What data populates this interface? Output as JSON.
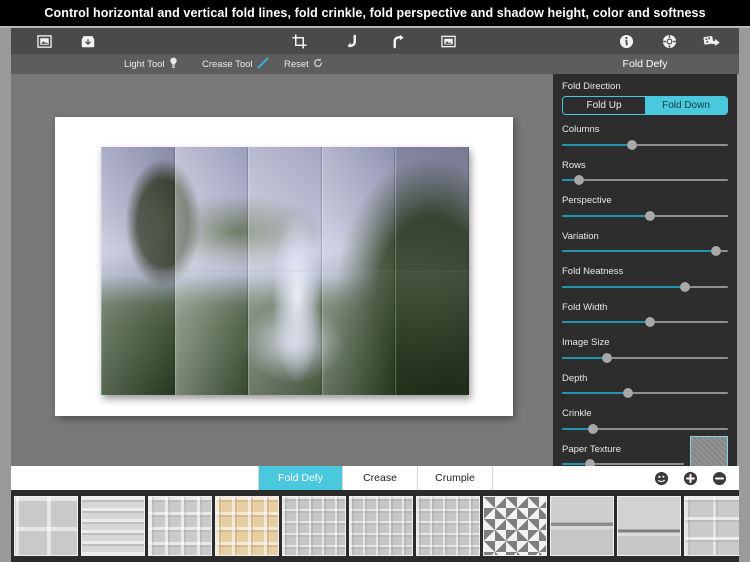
{
  "banner": {
    "text": "Control horizontal and vertical fold lines, fold crinkle, fold perspective and shadow height, color and softness"
  },
  "colors": {
    "accent": "#4ac8dd",
    "track_active": "#2196ae",
    "panel_bg": "#2d2d2d",
    "toolbar_bg": "#4a4a4a",
    "subbar_bg": "#5d5d5d",
    "canvas_bg": "#787878"
  },
  "toolbar": {
    "left_icons": [
      {
        "name": "open-image-icon",
        "label": "Open Image"
      },
      {
        "name": "save-image-icon",
        "label": "Save Image"
      }
    ],
    "center_icons": [
      {
        "name": "crop-icon",
        "label": "Crop"
      },
      {
        "name": "undo-icon",
        "label": "Undo"
      },
      {
        "name": "redo-icon",
        "label": "Redo"
      },
      {
        "name": "image-icon",
        "label": "Image"
      }
    ],
    "right_icons": [
      {
        "name": "info-icon",
        "label": "Info"
      },
      {
        "name": "settings-icon",
        "label": "Settings"
      },
      {
        "name": "share-icon",
        "label": "Share"
      }
    ]
  },
  "subbar": {
    "light_tool": "Light Tool",
    "crease_tool": "Crease Tool",
    "reset": "Reset",
    "effect_title": "Fold Defy"
  },
  "options": {
    "title": "Fold Defy",
    "fold_direction": {
      "label": "Fold Direction",
      "options": [
        "Fold Up",
        "Fold Down"
      ],
      "selected": "Fold Down"
    },
    "sliders": [
      {
        "label": "Columns",
        "value": 42
      },
      {
        "label": "Rows",
        "value": 10
      },
      {
        "label": "Perspective",
        "value": 53
      },
      {
        "label": "Variation",
        "value": 93
      },
      {
        "label": "Fold Neatness",
        "value": 74
      },
      {
        "label": "Fold Width",
        "value": 53
      },
      {
        "label": "Image Size",
        "value": 27
      },
      {
        "label": "Depth",
        "value": 40
      },
      {
        "label": "Crinkle",
        "value": 19
      }
    ],
    "paper_texture": {
      "label": "Paper Texture",
      "value": 23,
      "swatch_name": "paper-texture-swatch"
    }
  },
  "tabbar": {
    "tabs": [
      {
        "label": "Fold Defy",
        "active": true
      },
      {
        "label": "Crease",
        "active": false
      },
      {
        "label": "Crumple",
        "active": false
      }
    ],
    "actions": [
      {
        "name": "face-icon",
        "label": "Face"
      },
      {
        "name": "plus-icon",
        "label": "Add"
      },
      {
        "name": "minus-icon",
        "label": "Remove"
      }
    ]
  },
  "thumbnails": [
    {
      "name": "preset-quad-fold",
      "pattern": "pat-2x2"
    },
    {
      "name": "preset-horizontal-bands",
      "pattern": "pat-hstripe"
    },
    {
      "name": "preset-grid-white",
      "pattern": "pat-grid4"
    },
    {
      "name": "preset-grid-tan",
      "pattern": "pat-grid4 tan"
    },
    {
      "name": "preset-grid-soft",
      "pattern": "pat-grid-fine"
    },
    {
      "name": "preset-grid-fine",
      "pattern": "pat-grid-fine"
    },
    {
      "name": "preset-diagonal-blocks",
      "pattern": "pat-diag"
    },
    {
      "name": "preset-single-fold-mid",
      "pattern": "pat-1h"
    },
    {
      "name": "preset-single-fold-low",
      "pattern": "pat-1h-low"
    },
    {
      "name": "preset-mixed-panels",
      "pattern": "pat-mixed"
    },
    {
      "name": "preset-vertical-bands",
      "pattern": "pat-vstripe"
    },
    {
      "name": "preset-horizontal-wide",
      "pattern": "pat-hstripe3"
    }
  ],
  "canvas": {
    "image_name": "waterfall-landscape-photo",
    "fold_columns": 5,
    "fold_rows": 2
  }
}
